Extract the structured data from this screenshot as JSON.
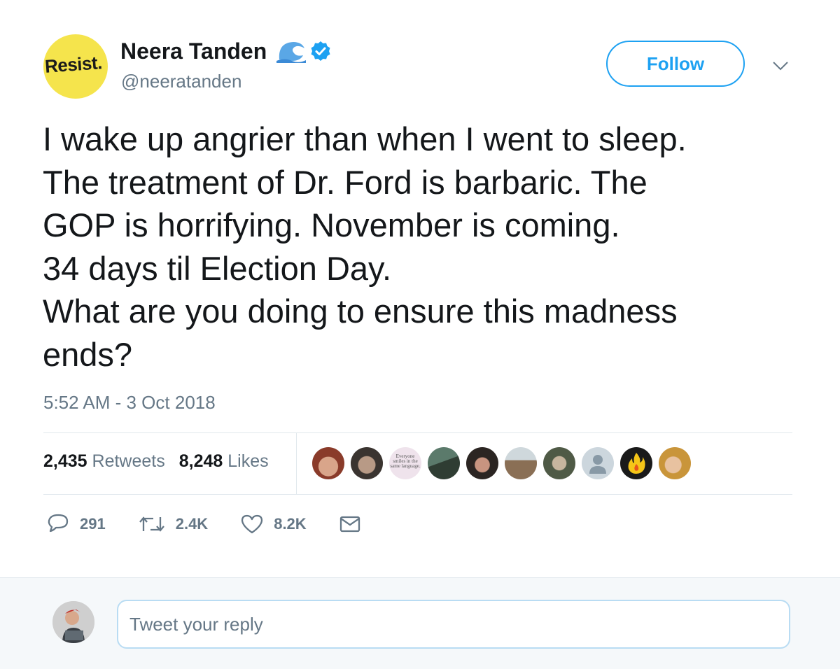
{
  "author": {
    "avatar_text": "Resist.",
    "name": "Neera Tanden",
    "handle": "@neeratanden"
  },
  "follow_label": "Follow",
  "tweet": {
    "lines": [
      "I wake up angrier than when I went to sleep.",
      "The treatment of Dr. Ford is barbaric. The",
      "GOP is horrifying. November is coming.",
      "34 days til Election Day.",
      "What are you doing to ensure this madness",
      "ends?"
    ],
    "timestamp": "5:52 AM - 3 Oct 2018"
  },
  "stats": {
    "retweets_count": "2,435",
    "retweets_label": "Retweets",
    "likes_count": "8,248",
    "likes_label": "Likes"
  },
  "liker_text_avatar": "Everyone smiles in the same language.",
  "actions": {
    "replies": "291",
    "retweets": "2.4K",
    "likes": "8.2K"
  },
  "reply": {
    "placeholder": "Tweet your reply"
  },
  "colors": {
    "brand_blue": "#1da1f2",
    "secondary_text": "#657786",
    "avatar_yellow": "#f5e44c"
  }
}
